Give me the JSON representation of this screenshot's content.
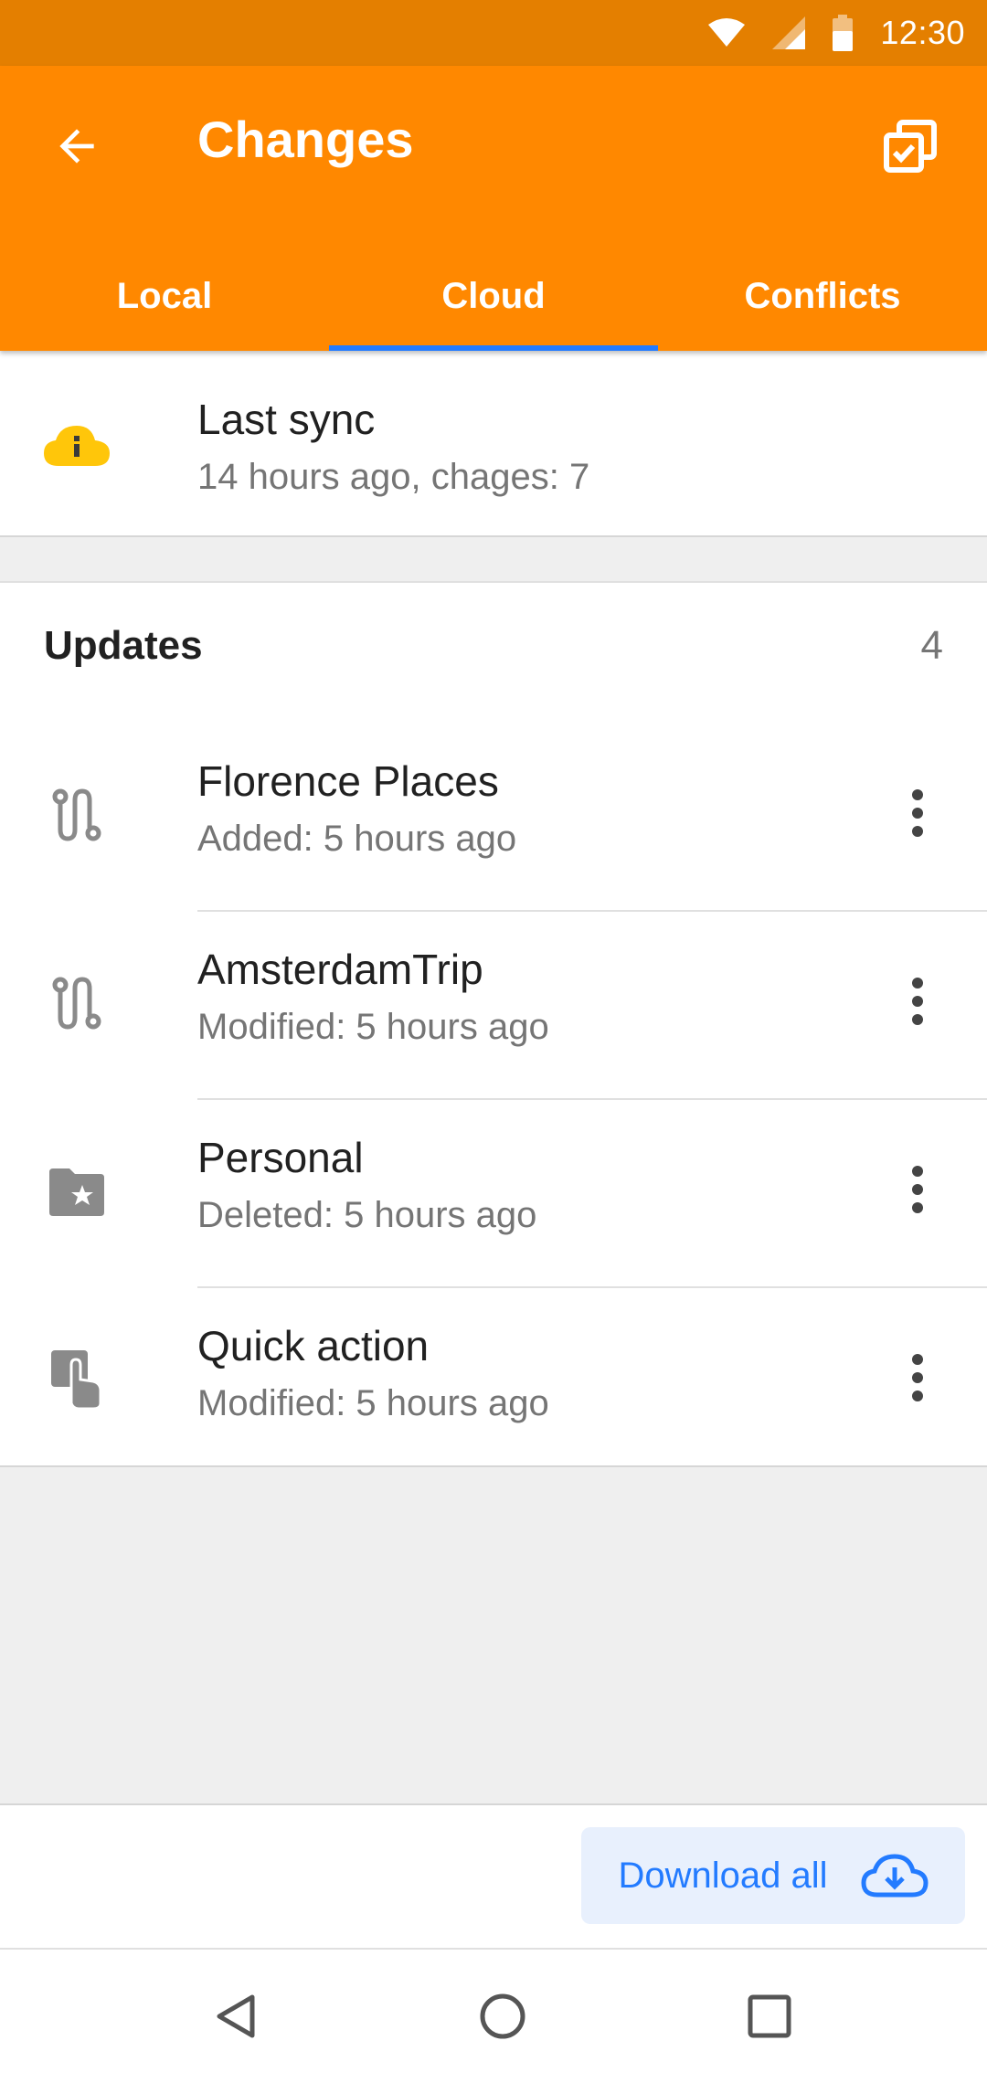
{
  "status_bar": {
    "time": "12:30",
    "icons": [
      "wifi-icon",
      "signal-icon",
      "battery-icon"
    ]
  },
  "app_bar": {
    "title": "Changes",
    "back_icon": "arrow-left-icon",
    "action_icon": "select-all-icon",
    "background_color": "#ff8800"
  },
  "tabs": [
    {
      "label": "Local",
      "active": false
    },
    {
      "label": "Cloud",
      "active": true
    },
    {
      "label": "Conflicts",
      "active": false
    }
  ],
  "sync": {
    "title": "Last sync",
    "subtitle": "14 hours ago, chages: 7",
    "icon": "cloud-info-icon",
    "icon_color": "#ffc60a"
  },
  "updates": {
    "header": "Updates",
    "count": "4",
    "items": [
      {
        "name": "Florence Places",
        "meta": "Added: 5 hours ago",
        "icon": "route-icon"
      },
      {
        "name": "AmsterdamTrip",
        "meta": "Modified: 5 hours ago",
        "icon": "route-icon"
      },
      {
        "name": "Personal",
        "meta": "Deleted: 5 hours ago",
        "icon": "folder-star-icon"
      },
      {
        "name": "Quick action",
        "meta": "Modified: 5 hours ago",
        "icon": "touch-icon"
      }
    ]
  },
  "bottom": {
    "download_label": "Download all",
    "download_icon": "cloud-download-icon",
    "accent_color": "#237bff"
  },
  "nav": {
    "icons": [
      "nav-back-icon",
      "nav-home-icon",
      "nav-recents-icon"
    ]
  }
}
